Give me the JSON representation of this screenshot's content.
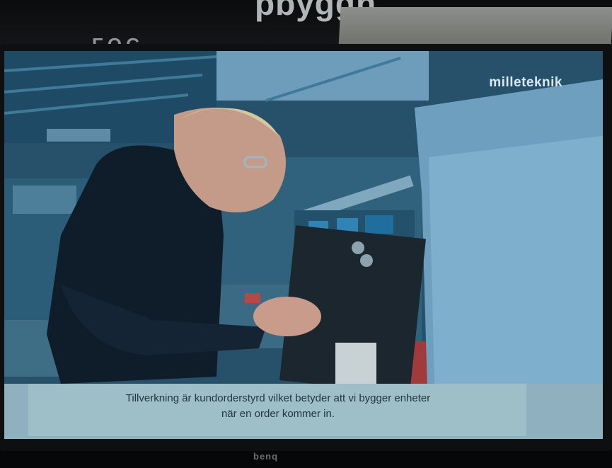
{
  "top_caption": "pbyggn",
  "top_fragment": "FOC",
  "screen": {
    "brand": "milleteknik",
    "subtitle_line1": "Tillverkning är kundorderstyrd vilket betyder att vi bygger enheter",
    "subtitle_line2": "när en order kommer in."
  },
  "monitor_brand": "benq",
  "colors": {
    "screen_tint": "#2a5b78",
    "caption_bg": "#9fbfc9",
    "caption_text": "#223641"
  }
}
